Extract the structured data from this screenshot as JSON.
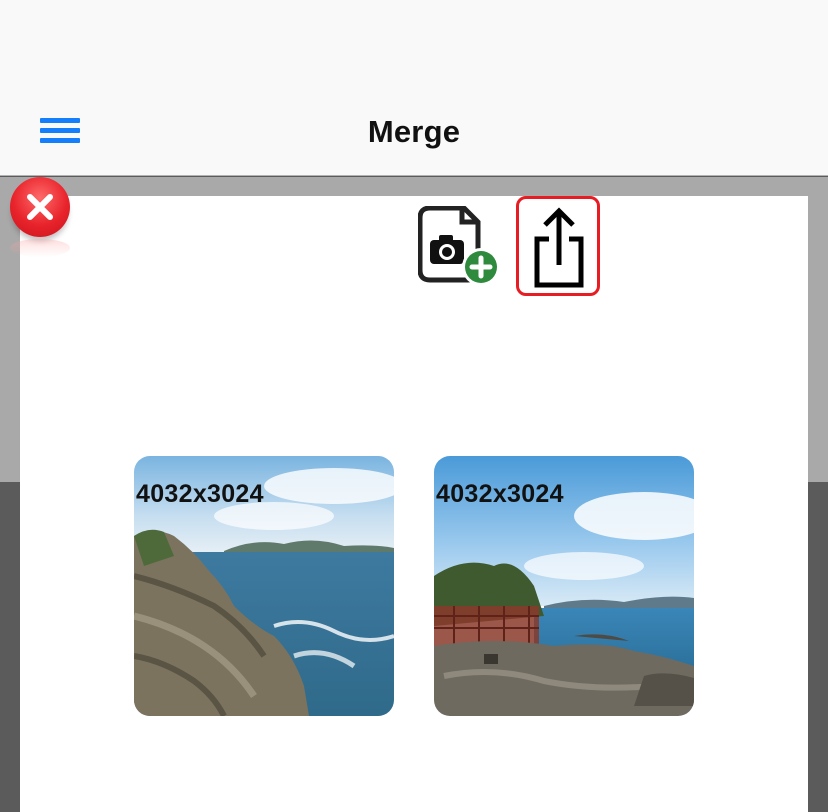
{
  "navbar": {
    "title": "Merge",
    "menu_icon": "hamburger-menu-icon"
  },
  "modal": {
    "close_icon": "close-x-icon",
    "toolbar": {
      "add_photo_icon": "add-photo-document-icon",
      "share_icon": "share-export-icon"
    },
    "images": [
      {
        "dimensions": "4032x3024"
      },
      {
        "dimensions": "4032x3024"
      }
    ]
  },
  "colors": {
    "accent": "#147efb",
    "close_red": "#e8232b",
    "share_highlight": "#e81d24",
    "add_green": "#2e8b3e"
  }
}
